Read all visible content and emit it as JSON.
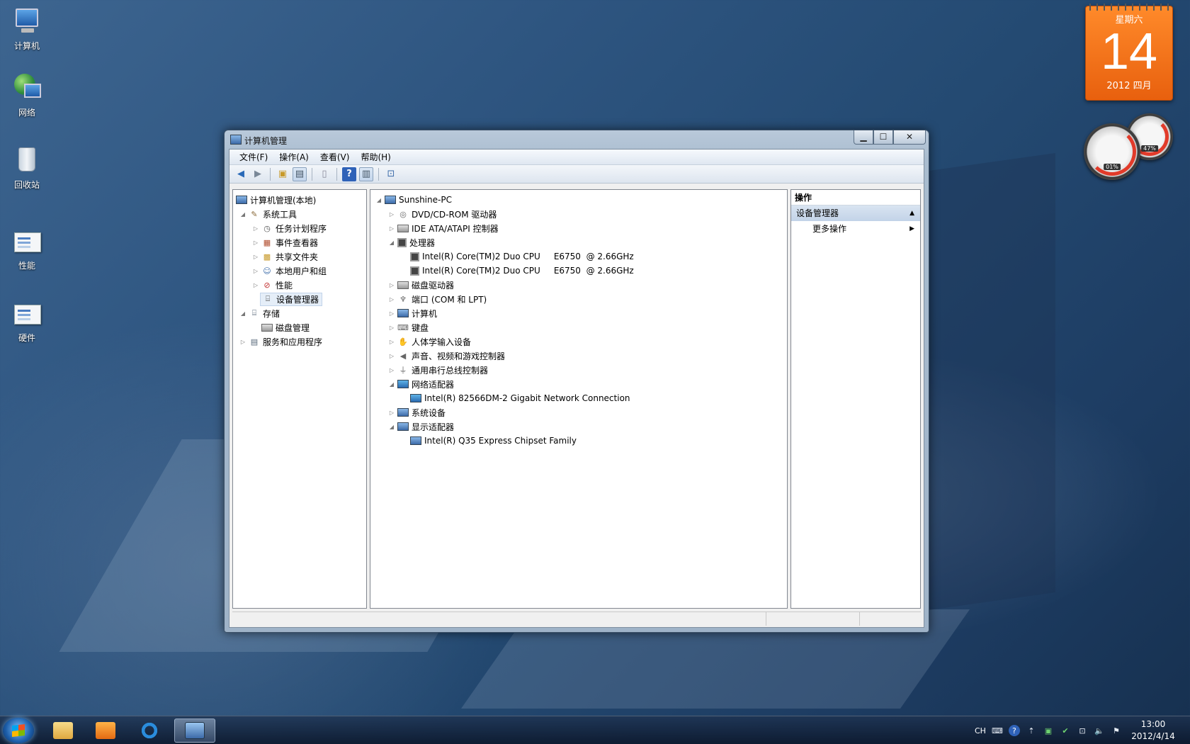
{
  "desktop": {
    "icons": [
      {
        "label": "计算机",
        "icon": "computer-icon"
      },
      {
        "label": "网络",
        "icon": "network-icon"
      },
      {
        "label": "回收站",
        "icon": "recycle-bin-icon"
      },
      {
        "label": "性能",
        "icon": "document-icon"
      },
      {
        "label": "硬件",
        "icon": "document-icon"
      }
    ]
  },
  "gadgets": {
    "calendar": {
      "weekday": "星期六",
      "day": "14",
      "year_month": "2012 四月"
    },
    "meters": {
      "cpu": "01%",
      "memory": "47%"
    }
  },
  "window": {
    "title": "计算机管理",
    "controls": {
      "minimize": "▁",
      "maximize": "☐",
      "close": "✕"
    },
    "menu": [
      "文件(F)",
      "操作(A)",
      "查看(V)",
      "帮助(H)"
    ]
  },
  "left_tree": {
    "root": "计算机管理(本地)",
    "system_tools": "系统工具",
    "task_scheduler": "任务计划程序",
    "event_viewer": "事件查看器",
    "shared_folders": "共享文件夹",
    "local_users": "本地用户和组",
    "performance": "性能",
    "device_manager": "设备管理器",
    "storage": "存储",
    "disk_management": "磁盘管理",
    "services_apps": "服务和应用程序"
  },
  "device_tree": {
    "root": "Sunshine-PC",
    "dvd": "DVD/CD-ROM 驱动器",
    "ide": "IDE ATA/ATAPI 控制器",
    "processors": "处理器",
    "cpu1": "Intel(R) Core(TM)2 Duo CPU     E6750  @ 2.66GHz",
    "cpu2": "Intel(R) Core(TM)2 Duo CPU     E6750  @ 2.66GHz",
    "disk_drives": "磁盘驱动器",
    "ports": "端口 (COM 和 LPT)",
    "computer": "计算机",
    "keyboard": "键盘",
    "hid": "人体学输入设备",
    "sound": "声音、视频和游戏控制器",
    "usb": "通用串行总线控制器",
    "network_adapters": "网络适配器",
    "nic": "Intel(R) 82566DM-2 Gigabit Network Connection",
    "system_devices": "系统设备",
    "display_adapters": "显示适配器",
    "gpu": "Intel(R) Q35 Express Chipset Family"
  },
  "actions": {
    "header": "操作",
    "group": "设备管理器",
    "more": "更多操作"
  },
  "taskbar": {
    "tray": {
      "lang": "CH"
    },
    "clock": {
      "time": "13:00",
      "date": "2012/4/14"
    }
  }
}
